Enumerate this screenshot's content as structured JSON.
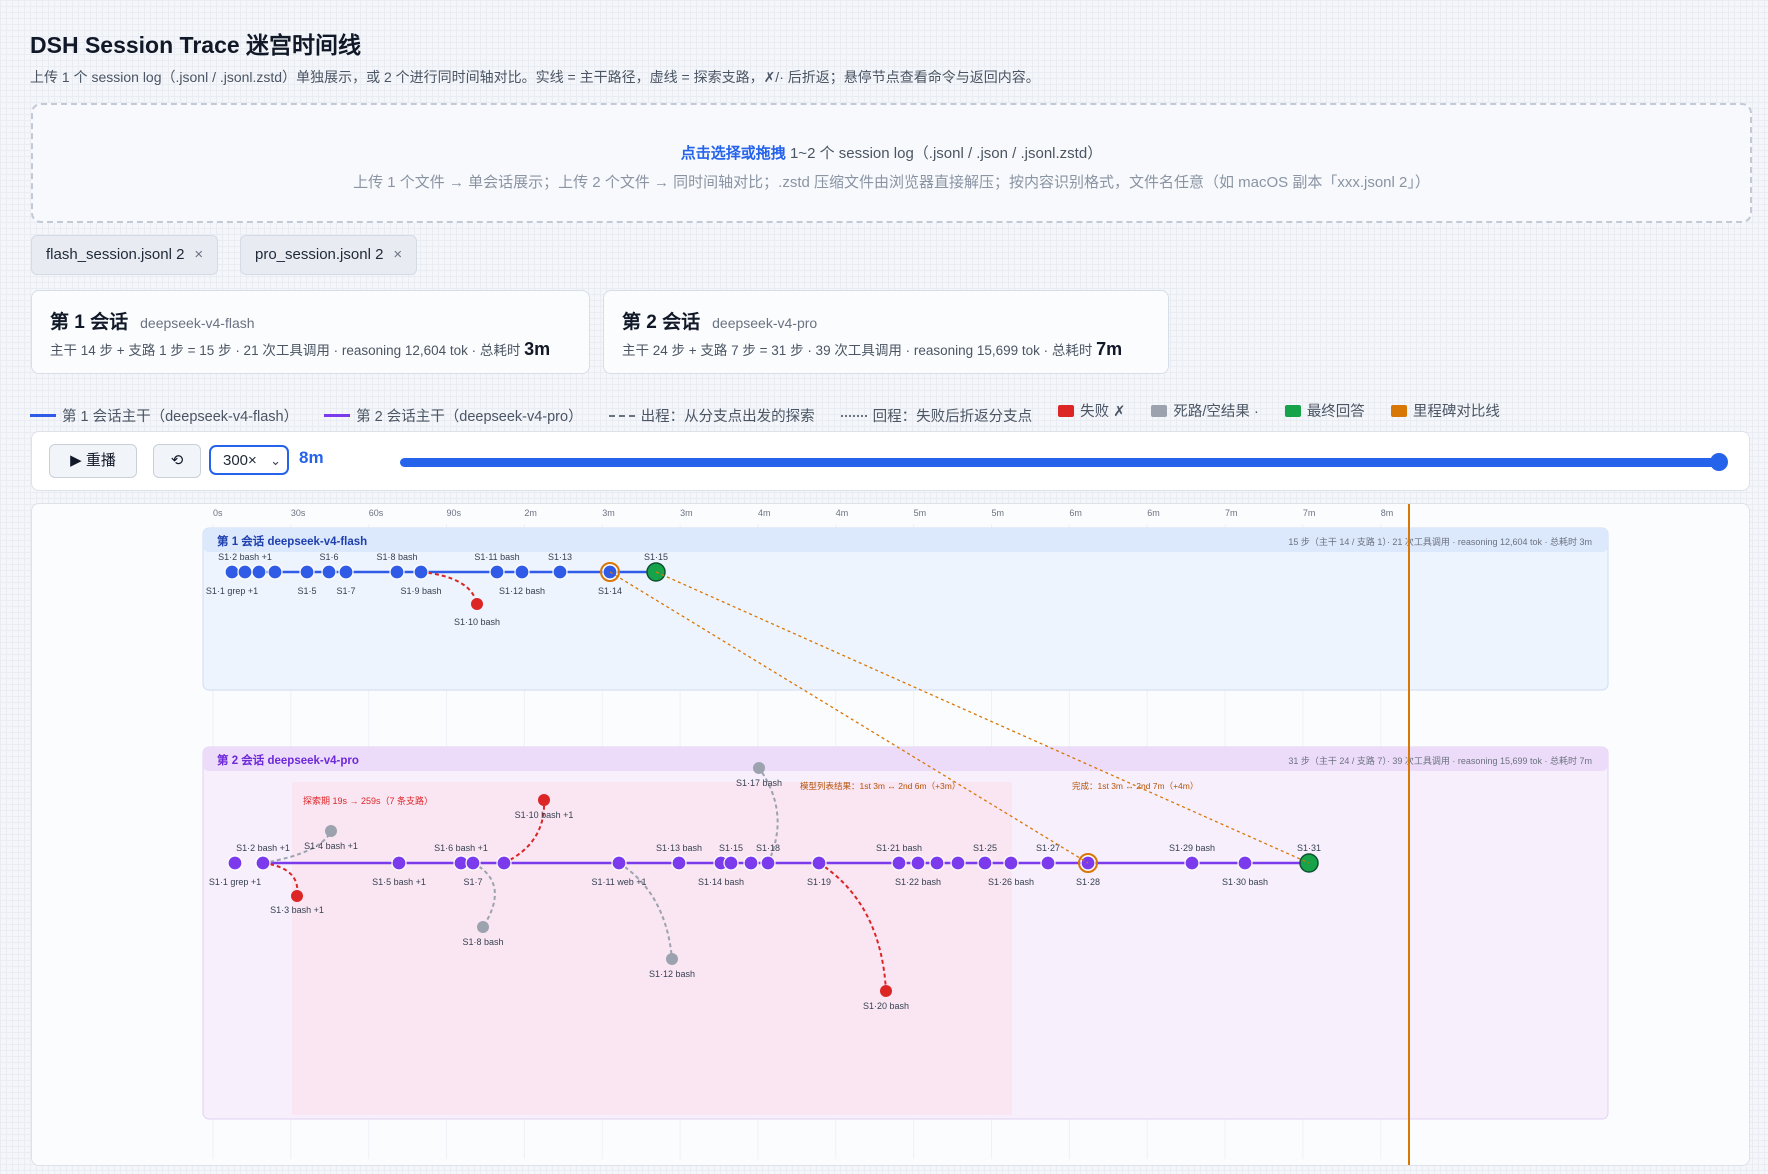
{
  "header": {
    "title": "DSH Session Trace 迷宫时间线",
    "subtitle": "上传 1 个 session log（.jsonl / .jsonl.zstd）单独展示，或 2 个进行同时间轴对比。实线 = 主干路径，虚线 = 探索支路，✗/· 后折返；悬停节点查看命令与返回内容。"
  },
  "dropzone": {
    "link": "点击选择或拖拽",
    "line1": " 1~2 个 session log（.jsonl / .json / .jsonl.zstd）",
    "line2": "上传 1 个文件 → 单会话展示；上传 2 个文件 → 同时间轴对比；.zstd 压缩文件由浏览器直接解压；按内容识别格式，文件名任意（如 macOS 副本「xxx.jsonl 2」）"
  },
  "files": [
    {
      "name": "flash_session.jsonl 2",
      "remove": "×"
    },
    {
      "name": "pro_session.jsonl 2",
      "remove": "×"
    }
  ],
  "sessions": [
    {
      "title": "第 1 会话",
      "model": "deepseek-v4-flash",
      "summary": "主干 14 步 + 支路 1 步 = 15 步 · 21 次工具调用 · reasoning 12,604 tok · 总耗时 ",
      "duration": "3m"
    },
    {
      "title": "第 2 会话",
      "model": "deepseek-v4-pro",
      "summary": "主干 24 步 + 支路 7 步 = 31 步 · 39 次工具调用 · reasoning 15,699 tok · 总耗时 ",
      "duration": "7m"
    }
  ],
  "legend": {
    "s1": "第 1 会话主干（deepseek-v4-flash）",
    "s2": "第 2 会话主干（deepseek-v4-pro）",
    "out": "出程：从分支点出发的探索",
    "back": "回程：失败后折返分支点",
    "fail": "失败 ✗",
    "dead": "死路/空结果 ·",
    "final": "最终回答",
    "milestone": "里程碑对比线",
    "colors": {
      "s1": "#2f5be7",
      "s2": "#7c3aed",
      "fail": "#dc2626",
      "dead": "#9ca3af",
      "final": "#16a34a",
      "milestone": "#d97706"
    }
  },
  "controls": {
    "replay": "▶ 重播",
    "reset": "⟲",
    "speed": "300×",
    "time": "8m",
    "progress": 1.0
  },
  "timeline": {
    "ticks": [
      "0s",
      "30s",
      "60s",
      "90s",
      "2m",
      "3m",
      "3m",
      "4m",
      "4m",
      "5m",
      "5m",
      "6m",
      "6m",
      "7m",
      "7m",
      "8m"
    ],
    "lane1": {
      "title": "第 1 会话 deepseek-v4-flash",
      "stats": "15 步（主干 14 / 支路 1）· 21 次工具调用 · reasoning 12,604 tok · 总耗时 3m",
      "labels": {
        "s1_2": "S1·2 bash +1",
        "s1_6": "S1·6",
        "s1_8": "S1·8 bash",
        "s1_11": "S1·11 bash",
        "s1_13": "S1·13",
        "s1_15": "S1·15",
        "s1_1": "S1·1 grep +1",
        "s1_5": "S1·5",
        "s1_7": "S1·7",
        "s1_9": "S1·9 bash",
        "s1_12": "S1·12 bash",
        "s1_14": "S1·14",
        "s1_10": "S1·10 bash"
      }
    },
    "lane2": {
      "title": "第 2 会话 deepseek-v4-pro",
      "stats": "31 步（主干 24 / 支路 7）· 39 次工具调用 · reasoning 15,699 tok · 总耗时 7m",
      "explore": "探索期 19s → 259s（7 条支路）",
      "milestone_note": "模型列表结果：1st 3m ↔ 2nd 6m（+3m）",
      "milestone_note2": "完成：1st 3m ↔ 2nd 7m（+4m）",
      "labels": {
        "s2_2": "S1·2 bash +1",
        "s2_4": "S1·4 bash +1",
        "s2_6": "S1·6 bash +1",
        "s2_10": "S1·10 bash +1",
        "s2_13": "S1·13 bash",
        "s2_15": "S1·15",
        "s2_18": "S1·18",
        "s2_17": "S1·17 bash",
        "s2_21": "S1·21 bash",
        "s2_25": "S1·25",
        "s2_27": "S1·27",
        "s2_29": "S1·29 bash",
        "s2_31": "S1·31",
        "s2_1": "S1·1 grep +1",
        "s2_5": "S1·5 bash +1",
        "s2_7": "S1·7",
        "s2_11": "S1·11 web +1",
        "s2_14": "S1·14 bash",
        "s2_19": "S1·19",
        "s2_22": "S1·22 bash",
        "s2_26": "S1·26 bash",
        "s2_28": "S1·28",
        "s2_30": "S1·30 bash",
        "s2_3": "S1·3 bash +1",
        "s2_8": "S1·8 bash",
        "s2_12": "S1·12 bash",
        "s2_20": "S1·20 bash"
      }
    }
  }
}
